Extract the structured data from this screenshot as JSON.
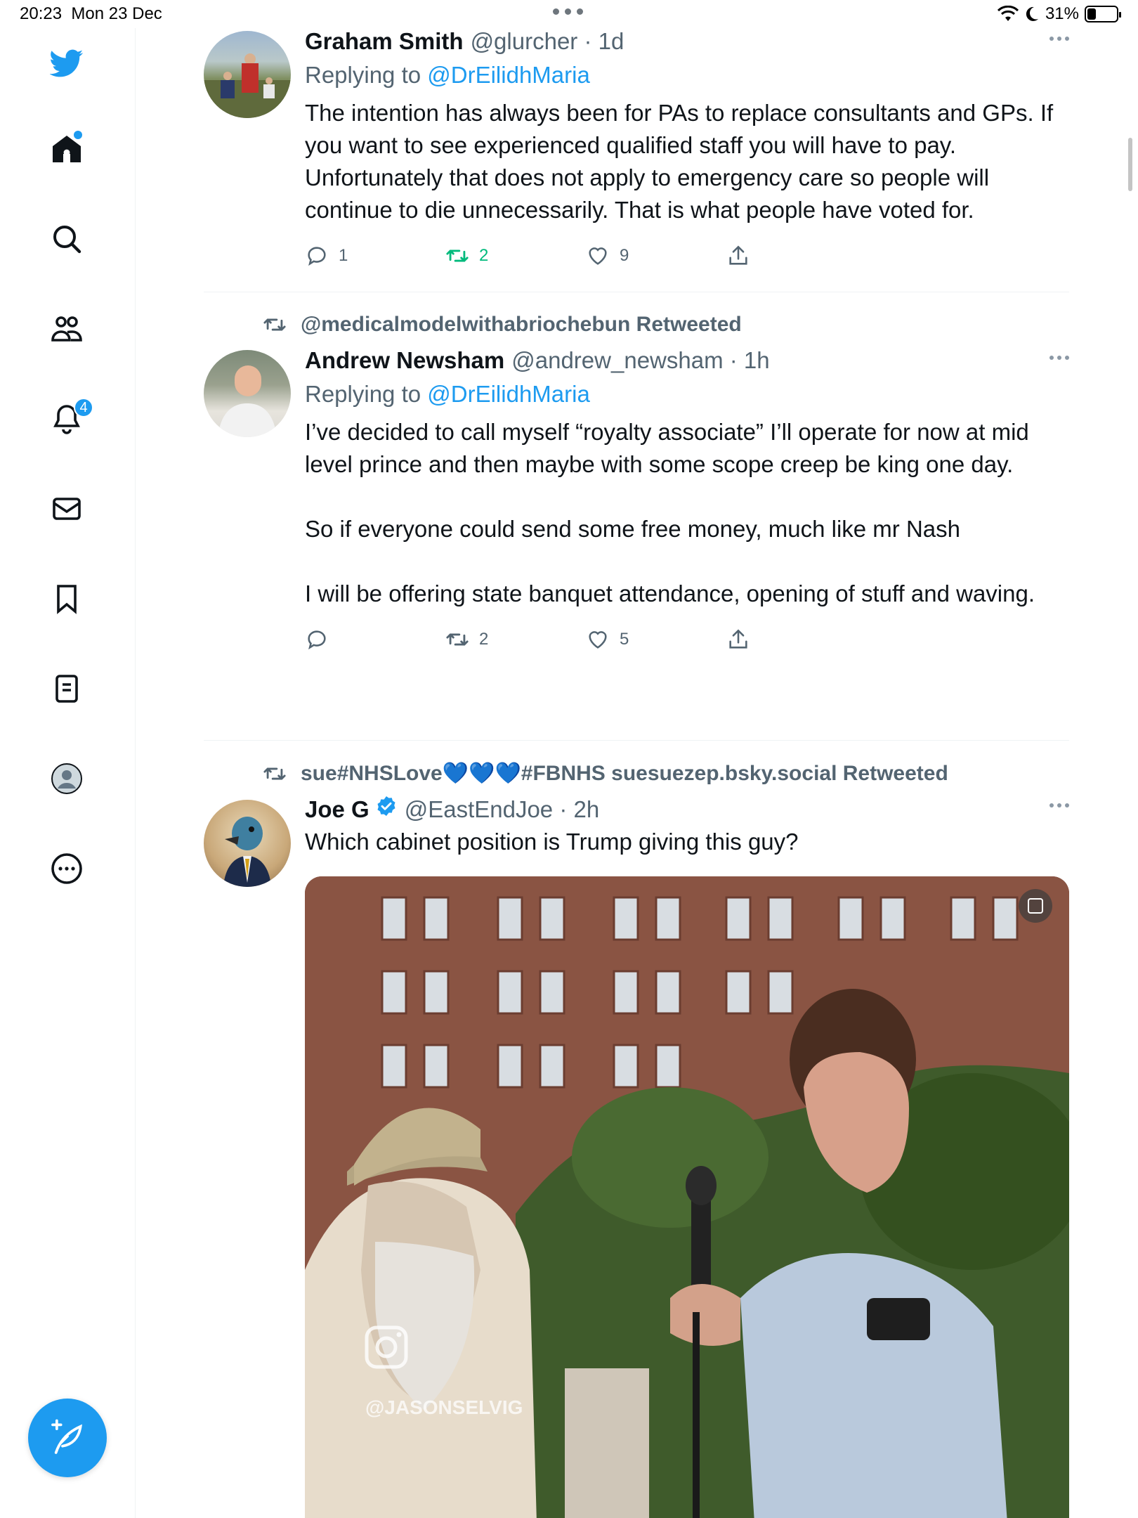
{
  "status_bar": {
    "time": "20:23",
    "date": "Mon 23 Dec",
    "battery_percent": "31%",
    "battery_level": 0.31
  },
  "sidebar": {
    "items": [
      {
        "name": "twitter-logo",
        "icon": "bird-icon"
      },
      {
        "name": "home",
        "icon": "home-icon"
      },
      {
        "name": "explore",
        "icon": "search-icon"
      },
      {
        "name": "communities",
        "icon": "people-icon"
      },
      {
        "name": "notifications",
        "icon": "bell-icon",
        "badge": "4"
      },
      {
        "name": "messages",
        "icon": "envelope-icon"
      },
      {
        "name": "bookmarks",
        "icon": "bookmark-icon"
      },
      {
        "name": "lists",
        "icon": "list-icon"
      },
      {
        "name": "profile",
        "icon": "profile-icon"
      },
      {
        "name": "more",
        "icon": "ellipsis-circle-icon"
      }
    ],
    "compose_icon": "compose-feather-icon"
  },
  "tweets": [
    {
      "name": "Graham Smith",
      "handle": "@glurcher · 1d",
      "replying_prefix": "Replying to ",
      "replying_to": "@DrEilidhMaria",
      "text": "The intention has always been for PAs to replace consultants and GPs. If you want to see experienced qualified staff you will have to pay. Unfortunately that does not apply to emergency care so people will continue to die unnecessarily. That is what people have voted for.",
      "replies": "1",
      "retweets": "2",
      "likes": "9"
    },
    {
      "retweeted_by": "@medicalmodelwithabriochebun Retweeted",
      "name": "Andrew Newsham",
      "handle": "@andrew_newsham · 1h",
      "replying_prefix": "Replying to ",
      "replying_to": "@DrEilidhMaria",
      "text": "I’ve decided to call myself “royalty associate” I’ll operate for now at mid level prince and then maybe with some scope creep be king one day.\n\nSo if everyone could send some free money, much like mr Nash\n\nI will be offering state banquet attendance, opening of stuff and waving.",
      "replies": "",
      "retweets": "2",
      "likes": "5"
    },
    {
      "retweeted_by": "sue#NHSLove💙💙💙#FBNHS suesuezep.bsky.social Retweeted",
      "name": "Joe G",
      "handle": "@EastEndJoe · 2h",
      "text": "Which cabinet position is Trump giving this guy?",
      "media_watermark": "@JASONSELVIG"
    }
  ]
}
